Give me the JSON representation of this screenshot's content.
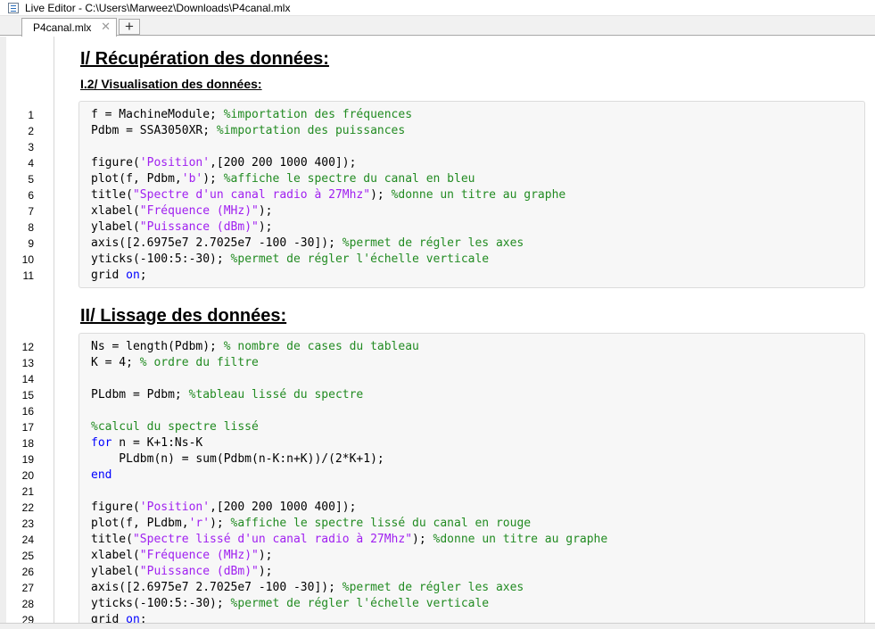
{
  "window": {
    "title": "Live Editor - C:\\Users\\Marweez\\Downloads\\P4canal.mlx"
  },
  "tabs": [
    {
      "label": "P4canal.mlx",
      "close": "✕"
    }
  ],
  "new_tab_label": "+",
  "sections": {
    "h1": "I/ Récupération des données:",
    "h1_sub": "I.2/ Visualisation des données:",
    "h2": "II/ Lissage des données:"
  },
  "code_block_1": [
    {
      "num": "1",
      "text": "f = MachineModule; %importation des fréquences"
    },
    {
      "num": "2",
      "text": "Pdbm = SSA3050XR; %importation des puissances"
    },
    {
      "num": "3",
      "text": ""
    },
    {
      "num": "4",
      "text": "figure('Position',[200 200 1000 400]);"
    },
    {
      "num": "5",
      "text": "plot(f, Pdbm,'b'); %affiche le spectre du canal en bleu"
    },
    {
      "num": "6",
      "text": "title(\"Spectre d'un canal radio à 27Mhz\"); %donne un titre au graphe"
    },
    {
      "num": "7",
      "text": "xlabel(\"Fréquence (MHz)\");"
    },
    {
      "num": "8",
      "text": "ylabel(\"Puissance (dBm)\");"
    },
    {
      "num": "9",
      "text": "axis([2.6975e7 2.7025e7 -100 -30]); %permet de régler les axes"
    },
    {
      "num": "10",
      "text": "yticks(-100:5:-30); %permet de régler l'échelle verticale"
    },
    {
      "num": "11",
      "text": "grid on;"
    }
  ],
  "code_block_2": [
    {
      "num": "12",
      "text": "Ns = length(Pdbm); % nombre de cases du tableau"
    },
    {
      "num": "13",
      "text": "K = 4; % ordre du filtre"
    },
    {
      "num": "14",
      "text": ""
    },
    {
      "num": "15",
      "text": "PLdbm = Pdbm; %tableau lissé du spectre"
    },
    {
      "num": "16",
      "text": ""
    },
    {
      "num": "17",
      "text": "%calcul du spectre lissé"
    },
    {
      "num": "18",
      "text": "for n = K+1:Ns-K"
    },
    {
      "num": "19",
      "text": "    PLdbm(n) = sum(Pdbm(n-K:n+K))/(2*K+1);"
    },
    {
      "num": "20",
      "text": "end"
    },
    {
      "num": "21",
      "text": ""
    },
    {
      "num": "22",
      "text": "figure('Position',[200 200 1000 400]);"
    },
    {
      "num": "23",
      "text": "plot(f, PLdbm,'r'); %affiche le spectre lissé du canal en rouge"
    },
    {
      "num": "24",
      "text": "title(\"Spectre lissé d'un canal radio à 27Mhz\"); %donne un titre au graphe"
    },
    {
      "num": "25",
      "text": "xlabel(\"Fréquence (MHz)\");"
    },
    {
      "num": "26",
      "text": "ylabel(\"Puissance (dBm)\");"
    },
    {
      "num": "27",
      "text": "axis([2.6975e7 2.7025e7 -100 -30]); %permet de régler les axes"
    },
    {
      "num": "28",
      "text": "yticks(-100:5:-30); %permet de régler l'échelle verticale"
    },
    {
      "num": "29",
      "text": "grid on;"
    }
  ],
  "colors": {
    "comment": "#228B22",
    "string": "#A020F0",
    "keyword": "#0000FF",
    "code_background": "#F7F7F7"
  },
  "icons": {
    "app": "live-editor-icon",
    "close": "close-icon",
    "add": "plus-icon"
  }
}
